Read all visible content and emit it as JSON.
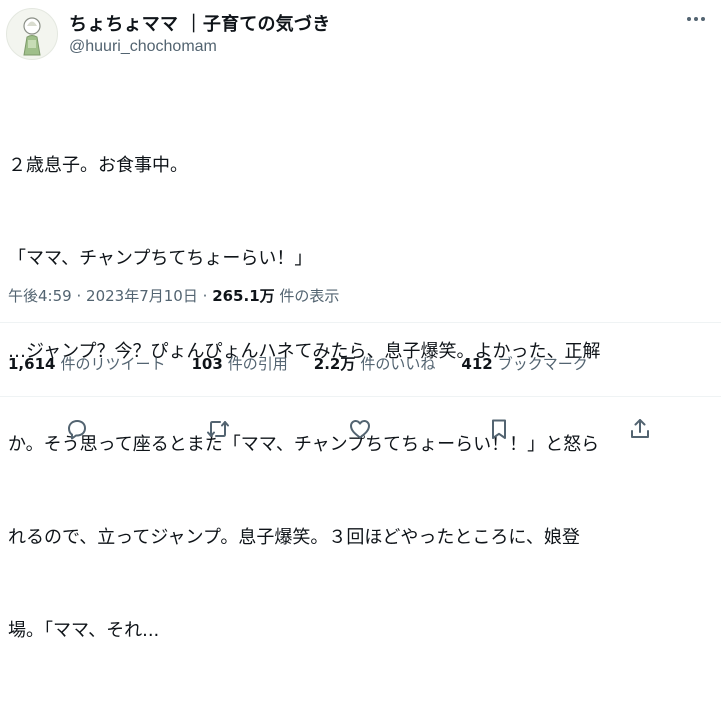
{
  "author": {
    "display_name": "ちょちょママ ｜子育ての気づき",
    "handle": "@huuri_chochomam",
    "avatar_icon": "person-illustration-icon"
  },
  "tweet": {
    "lines": [
      "２歳息子。お食事中。",
      "「ママ、チャンプちてちょーらい！」",
      "…ジャンプ？今？ぴょんぴょんハネてみたら、息子爆笑。よかった、正解",
      "か。そう思って座るとまた「ママ、チャンプちてちょーらい！！」と怒ら",
      "れるので、立ってジャンプ。息子爆笑。３回ほどやったところに、娘登",
      "場。「ママ、それ..."
    ]
  },
  "meta": {
    "time": "午後4:59",
    "date": "2023年7月10日",
    "views_count": "265.1万",
    "views_label": "件の表示",
    "sep": "·"
  },
  "stats": [
    {
      "count": "1,614",
      "label": "件のリツイート"
    },
    {
      "count": "103",
      "label": "件の引用"
    },
    {
      "count": "2.2万",
      "label": "件のいいね"
    },
    {
      "count": "412",
      "label": "ブックマーク"
    }
  ],
  "actions": [
    "reply-icon",
    "retweet-icon",
    "like-icon",
    "bookmark-icon",
    "share-icon"
  ],
  "colors": {
    "text": "#0f1419",
    "secondary": "#536471",
    "divider": "#eff3f4"
  }
}
